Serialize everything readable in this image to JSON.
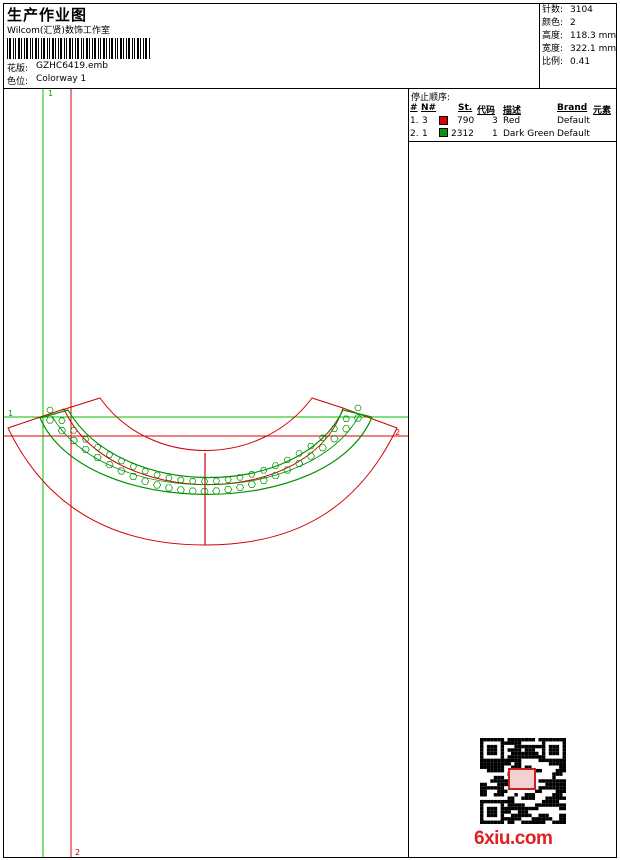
{
  "header": {
    "title": "生产作业图",
    "studio": "Wilcom(汇贤)数饰工作室",
    "design_label": "花版:",
    "design_file": "GZHC6419.emb",
    "colorway_label": "色位:",
    "colorway": "Colorway 1"
  },
  "stats": [
    {
      "label": "针数:",
      "value": "3104"
    },
    {
      "label": "颜色:",
      "value": "2"
    },
    {
      "label": "高度:",
      "value": "118.3 mm"
    },
    {
      "label": "宽度:",
      "value": "322.1 mm"
    },
    {
      "label": "比例:",
      "value": "0.41"
    }
  ],
  "stop_sequence": {
    "title": "停止顺序:",
    "headers": {
      "num": "#",
      "n": "N#",
      "st": "St.",
      "code": "代码",
      "desc": "描述",
      "brand": "Brand",
      "element": "元素"
    },
    "rows": [
      {
        "num": "1.",
        "n": "3",
        "color": "#e00000",
        "st": "790",
        "code": "3",
        "desc": "Red",
        "brand": "Default"
      },
      {
        "num": "2.",
        "n": "1",
        "color": "#109010",
        "st": "2312",
        "code": "1",
        "desc": "Dark Green",
        "brand": "Default"
      }
    ]
  },
  "canvas": {
    "guide_labels": {
      "v1": "1",
      "h1": "1",
      "v2": "2",
      "h2": "2"
    },
    "colors": {
      "green_guide": "#00c000",
      "red_guide": "#e00000",
      "outline": "#d00000",
      "fill_pattern": "#009000"
    }
  },
  "watermark": {
    "text": "6xiu.com",
    "color": "#e02020"
  }
}
